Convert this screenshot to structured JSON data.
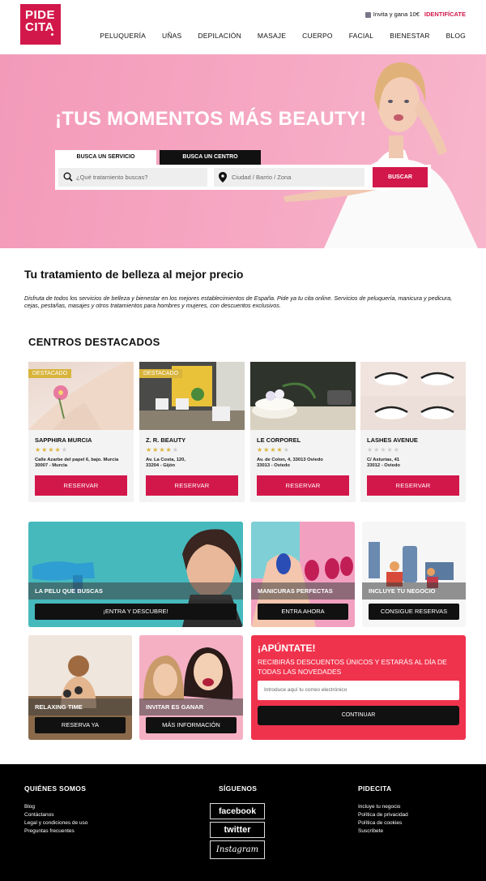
{
  "header": {
    "logo_line1": "PIDE",
    "logo_line2": "CITA",
    "invite": "Invita y gana 10€",
    "login": "IDENTIFÍCATE",
    "nav": [
      "PELUQUERÍA",
      "UÑAS",
      "DEPILACIÓN",
      "MASAJE",
      "CUERPO",
      "FACIAL",
      "BIENESTAR",
      "BLOG"
    ]
  },
  "hero": {
    "title": "¡TUS MOMENTOS MÁS BEAUTY!",
    "tab_service": "BUSCA UN SERVICIO",
    "tab_center": "BUSCA UN CENTRO",
    "service_placeholder": "¿Qué tratamiento buscas?",
    "location_placeholder": "Ciudad / Barrio / Zona",
    "search_button": "BUSCAR"
  },
  "intro": {
    "title": "Tu tratamiento de belleza al mejor precio",
    "text": "Disfruta de todos los servicios de belleza y bienestar en los mejores establecimientos de España. Pide ya tu cita online. Servicios de peluquería, manicura y pedicura, cejas, pestañas, masajes y otros tratamientos para hombres y mujeres, con descuentos exclusivos."
  },
  "featured": {
    "title": "CENTROS DESTACADOS",
    "badge": "DESTACADO",
    "button": "RESERVAR",
    "centers": [
      {
        "name": "SAPPHIRA MURCIA",
        "stars": 4,
        "addr1": "Calle Azarbe del papel 6, bajo. Murcia",
        "addr2": "30007 - Murcia",
        "featured": true
      },
      {
        "name": "Z. R. BEAUTY",
        "stars": 4,
        "addr1": "Av. La Costa, 120,",
        "addr2": "33204 - Gijón",
        "featured": true
      },
      {
        "name": "LE CORPOREL",
        "stars": 4,
        "addr1": "Av. de Colon, 4, 33013 Oviedo",
        "addr2": "33013 - Oviedo",
        "featured": false
      },
      {
        "name": "LASHES AVENUE",
        "stars": 0,
        "addr1": "C/ Asturias, 41",
        "addr2": "33012 - Oviedo",
        "featured": false
      }
    ]
  },
  "promos": {
    "pelu_label": "LA PELU QUE BUSCAS",
    "pelu_cta": "¡ENTRA Y DESCUBRE!",
    "manicura_label": "MANICURAS PERFECTAS",
    "manicura_cta": "ENTRA AHORA",
    "negocio_label": "INCLUYE TU NEGOCIO",
    "negocio_cta": "CONSIGUE RESERVAS",
    "relax_label": "RELAXING TIME",
    "relax_cta": "RESERVA YA",
    "invitar_label": "INVITAR ES GANAR",
    "invitar_cta": "MÁS INFORMACIÓN"
  },
  "newsletter": {
    "title": "¡APÚNTATE!",
    "text": "RECIBIRÁS DESCUENTOS ÚNICOS Y ESTARÁS AL DÍA DE TODAS LAS NOVEDADES",
    "placeholder": "Introduce aquí tu correo electrónico",
    "button": "CONTINUAR"
  },
  "footer": {
    "about_title": "QUIÉNES SOMOS",
    "about_links": [
      "Blog",
      "Contáctanos",
      "Legal y condiciones de uso",
      "Preguntas frecuentes"
    ],
    "social_title": "SÍGUENOS",
    "social": [
      "facebook",
      "twitter",
      "Instagram"
    ],
    "brand_title": "PIDECITA",
    "brand_links": [
      "Incluye tu negocio",
      "Política de privacidad",
      "Política de cookies",
      "Suscríbete"
    ]
  }
}
